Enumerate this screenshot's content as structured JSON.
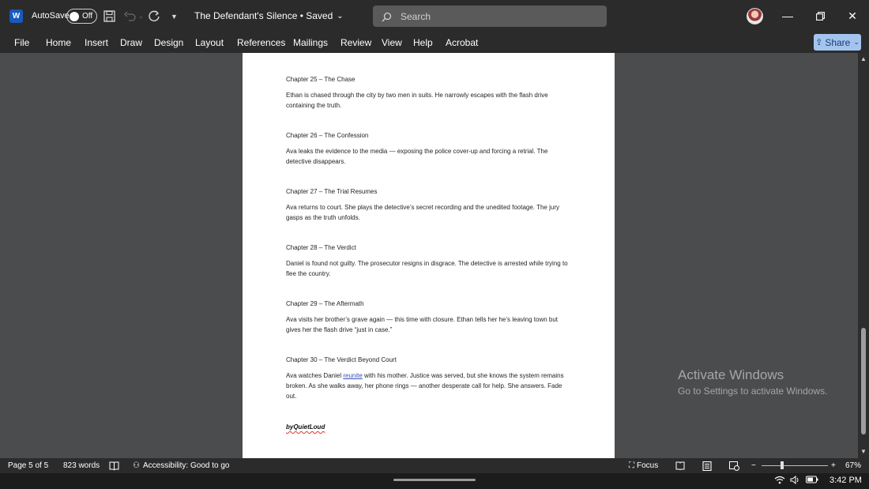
{
  "titlebar": {
    "app_icon": "word-logo-icon",
    "app_letter": "W",
    "autosave_label": "AutoSave",
    "autosave_state": "Off",
    "doc_title": "The Defendant's Silence • Saved",
    "search_placeholder": "Search"
  },
  "ribbon": {
    "tabs": [
      "File",
      "Home",
      "Insert",
      "Draw",
      "Design",
      "Layout",
      "References",
      "Mailings",
      "Review",
      "View",
      "Help",
      "Acrobat"
    ],
    "share_label": "Share"
  },
  "document": {
    "paragraphs": [
      "Chapter 25 – The Chase",
      "Ethan is chased through the city by two men in suits. He narrowly escapes with the flash drive containing the truth.",
      "Chapter 26 – The Confession",
      "Ava leaks the evidence to the media — exposing the police cover-up and forcing a retrial. The detective disappears.",
      "Chapter 27 – The Trial Resumes",
      "Ava returns to court. She plays the detective’s secret recording and the unedited footage. The jury gasps as the truth unfolds.",
      "Chapter 28 – The Verdict",
      "Daniel is found not guilty. The prosecutor resigns in disgrace. The detective is arrested while trying to flee the country.",
      "Chapter 29 – The Aftermath",
      "Ava visits her brother’s grave again — this time with closure. Ethan tells her he’s leaving town but gives her the flash drive “just in case.”",
      "Chapter 30 – The Verdict Beyond Court"
    ],
    "last_para_a": "Ava watches Daniel ",
    "last_para_link": "reunite",
    "last_para_b": " with his mother. Justice was served, but she knows the system remains broken. As she walks away, her phone rings — another desperate call for help. She answers. Fade out.",
    "signature": "byQuietLoud"
  },
  "watermark": {
    "title": "Activate Windows",
    "subtitle": "Go to Settings to activate Windows."
  },
  "statusbar": {
    "page": "Page 5 of 5",
    "words": "823 words",
    "accessibility": "Accessibility: Good to go",
    "focus": "Focus",
    "zoom": "67%",
    "zoom_fraction": 0.67
  },
  "taskbar": {
    "time": "3:42 PM"
  }
}
